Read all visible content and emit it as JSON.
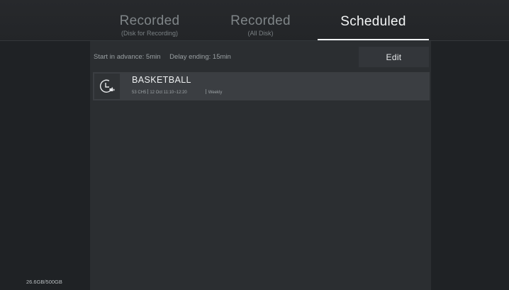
{
  "tabs": [
    {
      "title": "Recorded",
      "subtitle": "(Disk for Recording)"
    },
    {
      "title": "Recorded",
      "subtitle": "(All Disk)"
    },
    {
      "title": "Scheduled",
      "subtitle": ""
    }
  ],
  "active_tab": "Scheduled",
  "settings": {
    "start_advance": "Start in advance: 5min",
    "delay_ending": "Delay ending: 15min"
  },
  "edit_label": "Edit",
  "schedule": [
    {
      "title": "BASKETBALL",
      "channel": "53 CH5",
      "time": "12 Oct 11:10~12:20",
      "repeat": "Weekly",
      "icon": "clock-record-icon"
    }
  ],
  "storage": "26.6GB/500GB",
  "colors": {
    "background": "#1f2225",
    "panel": "#2b2e31",
    "item": "#3b3e42",
    "active_underline": "#f1f3f4"
  }
}
